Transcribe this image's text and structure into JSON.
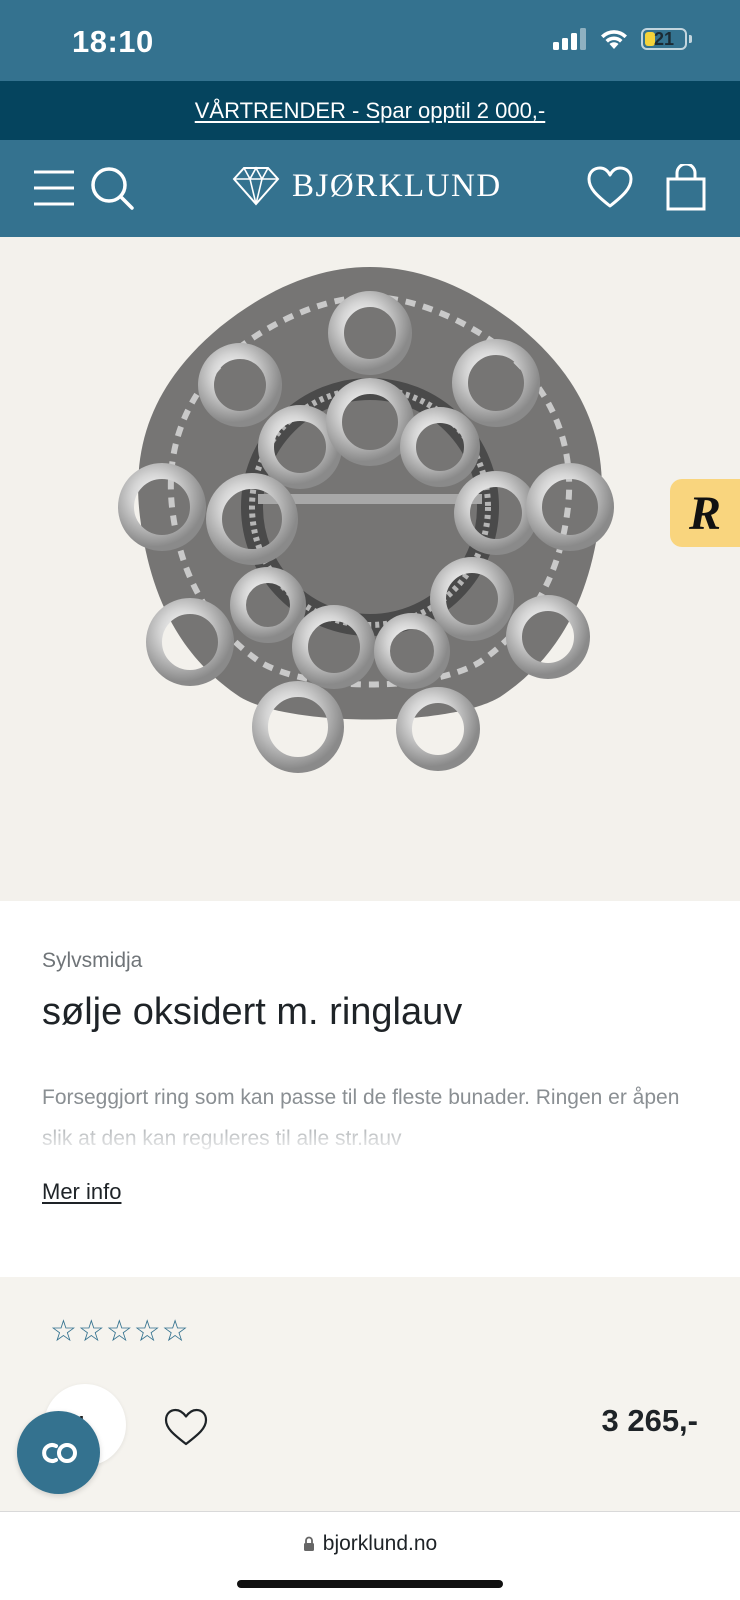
{
  "status_bar": {
    "time": "18:10",
    "battery_level": "21",
    "battery_color": "#f4d33a"
  },
  "promo": {
    "text": "VÅRTRENDER - Spar opptil 2 000,-"
  },
  "header": {
    "logo_text": "BJØRKLUND",
    "icons": [
      "menu-icon",
      "search-icon",
      "diamond-logo-icon",
      "heart-icon",
      "shopping-bag-icon"
    ],
    "background_color": "#34728f"
  },
  "product": {
    "brand": "Sylvsmidja",
    "title": "sølje oksidert m. ringlauv",
    "description": "Forseggjort ring som kan passe til de fleste bunader. Ringen er åpen slik at den kan reguleres til alle str.lauv",
    "more_info_label": "Mer info",
    "rating_stars": 5,
    "rating_value": 0,
    "price": "3 265,-",
    "quantity": "1"
  },
  "badge": {
    "letter": "R",
    "color": "#f9d57e"
  },
  "browser": {
    "url": "bjorklund.no"
  },
  "colors": {
    "brand_teal": "#34728f",
    "promo_navy": "#05445e",
    "image_bg": "#f3f1ec"
  }
}
